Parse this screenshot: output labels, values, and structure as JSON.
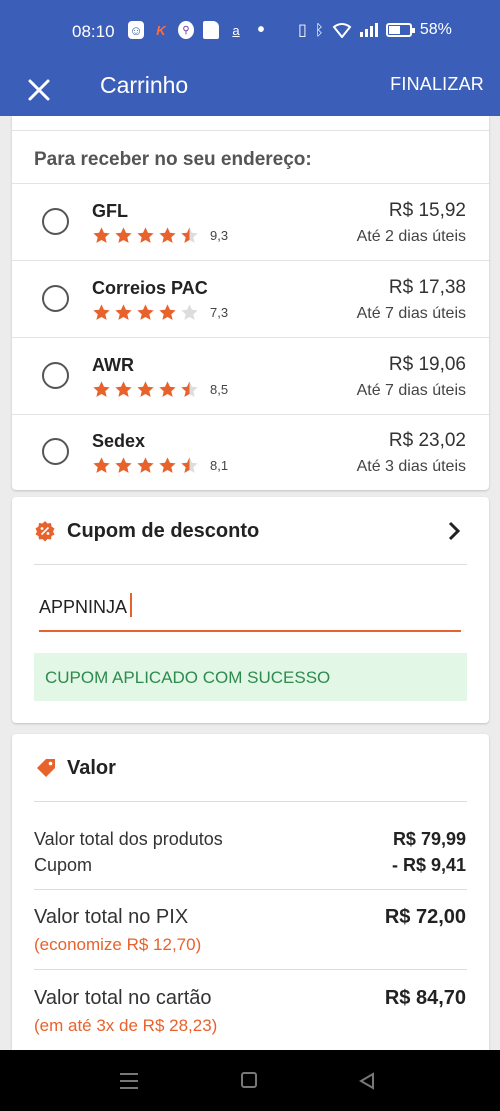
{
  "status_bar": {
    "time": "08:10",
    "battery": "58%",
    "battery_level": 0.58
  },
  "app_bar": {
    "title": "Carrinho",
    "close_icon": "close-icon",
    "finalize_label": "FINALIZAR"
  },
  "shipping": {
    "heading": "Para receber no seu endereço:",
    "options": [
      {
        "name": "GFL",
        "rating": 4.5,
        "score": "9,3",
        "price": "R$ 15,92",
        "eta": "Até 2 dias úteis"
      },
      {
        "name": "Correios PAC",
        "rating": 4,
        "score": "7,3",
        "price": "R$ 17,38",
        "eta": "Até 7 dias úteis"
      },
      {
        "name": "AWR",
        "rating": 4.5,
        "score": "8,5",
        "price": "R$ 19,06",
        "eta": "Até 7 dias úteis"
      },
      {
        "name": "Sedex",
        "rating": 4.5,
        "score": "8,1",
        "price": "R$ 23,02",
        "eta": "Até 3 dias úteis"
      }
    ]
  },
  "coupon": {
    "heading": "Cupom de desconto",
    "code": "APPNINJA",
    "success_message": "CUPOM APLICADO COM SUCESSO"
  },
  "totals": {
    "heading": "Valor",
    "products_label": "Valor total dos produtos",
    "products_value": "R$ 79,99",
    "coupon_label": "Cupom",
    "coupon_value": "- R$ 9,41",
    "pix_label": "Valor total no PIX",
    "pix_value": "R$ 72,00",
    "pix_note": "(economize R$ 12,70)",
    "card_label": "Valor total no cartão",
    "card_value": "R$ 84,70",
    "card_note": "(em até 3x de R$ 28,23)"
  },
  "colors": {
    "primary": "#3b5fb8",
    "accent": "#e8622c",
    "star": "#e8622c",
    "success_bg": "#e2f7e6",
    "success_text": "#2e8b4e"
  }
}
